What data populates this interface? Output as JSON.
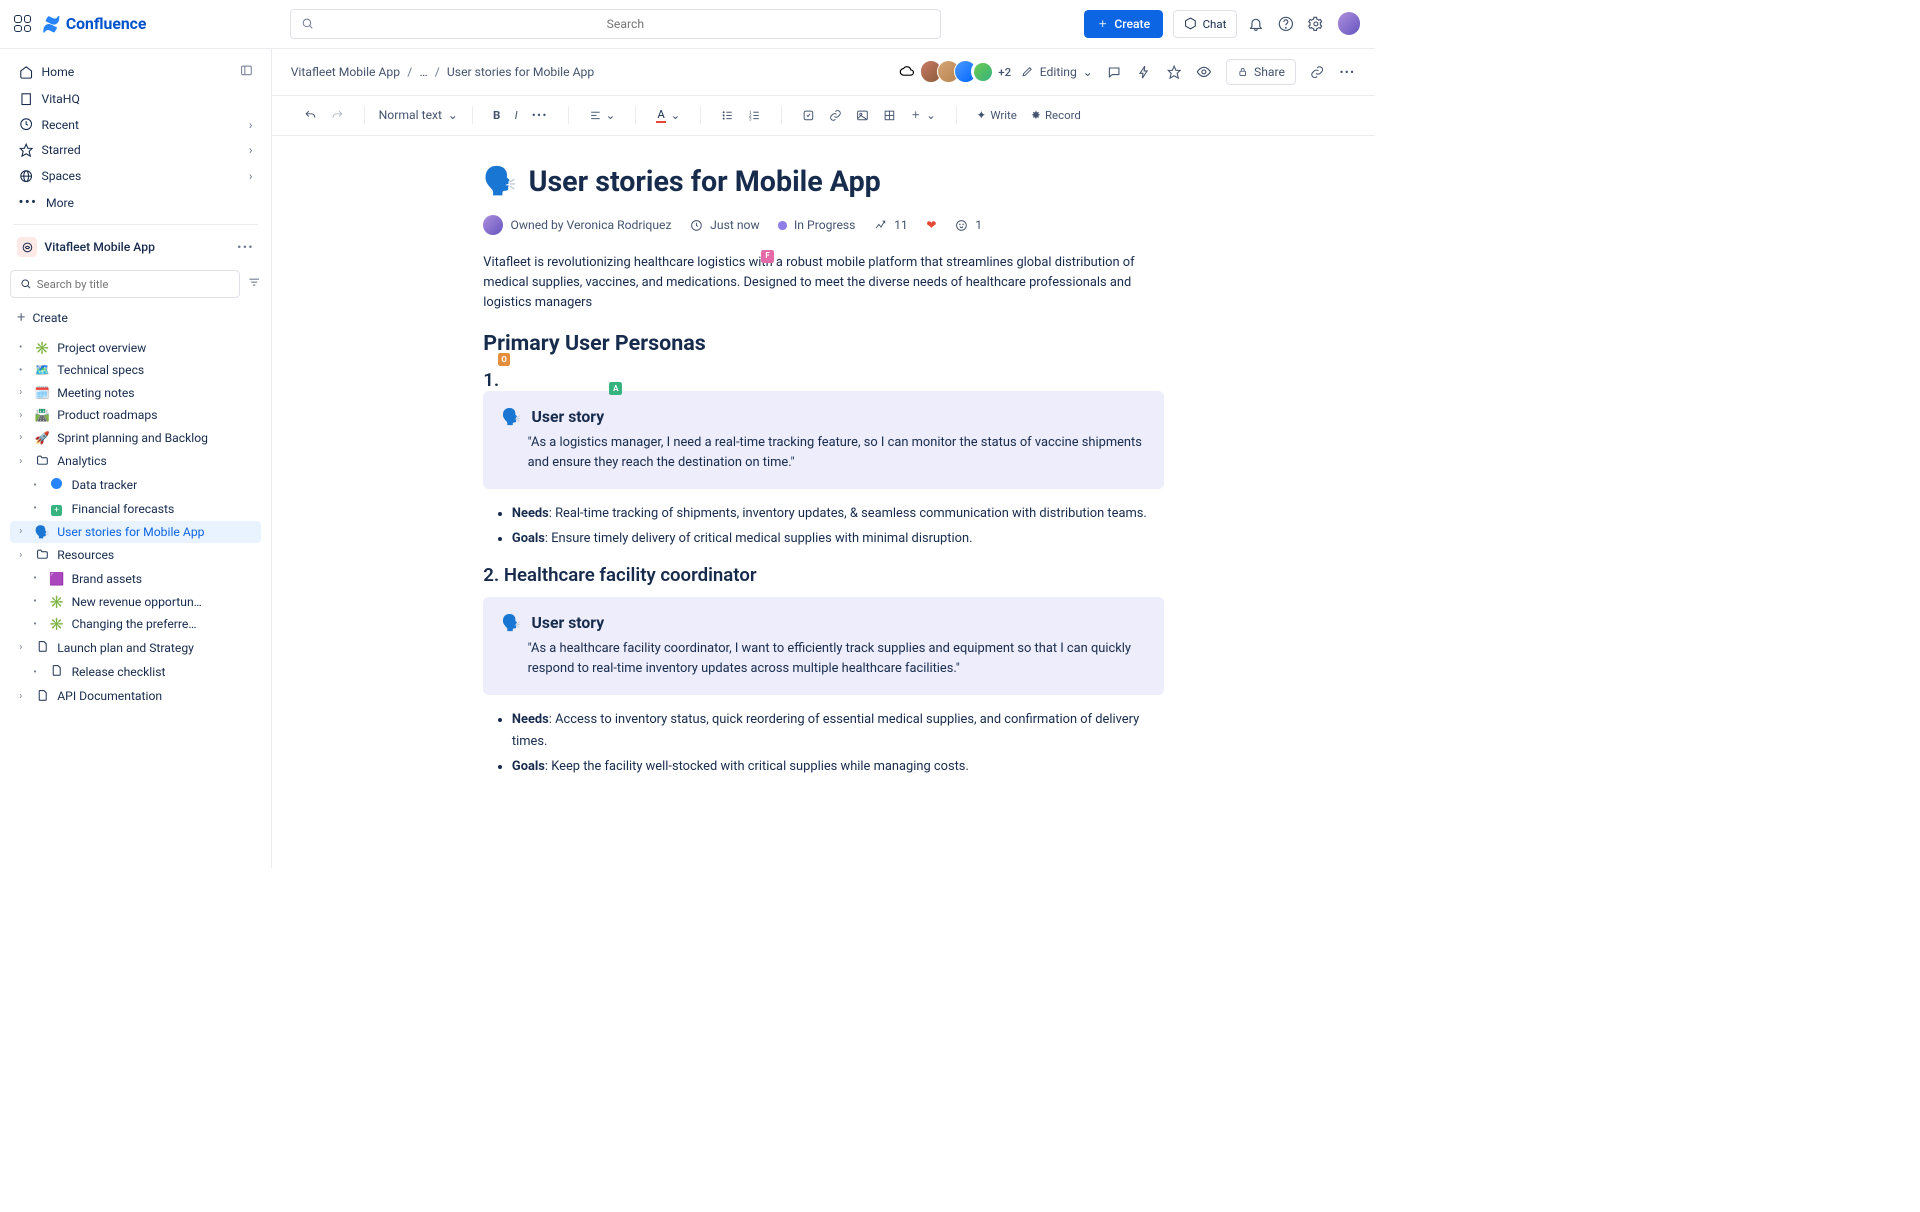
{
  "topbar": {
    "product": "Confluence",
    "search_placeholder": "Search",
    "create": "Create",
    "chat": "Chat"
  },
  "sidebar": {
    "home": "Home",
    "vitahq": "VitaHQ",
    "recent": "Recent",
    "starred": "Starred",
    "spaces": "Spaces",
    "more": "More",
    "space_name": "Vitafleet Mobile App",
    "search_placeholder": "Search by title",
    "create": "Create",
    "tree": [
      {
        "icon": "✳️",
        "label": "Project overview",
        "type": "dot"
      },
      {
        "icon": "🗺️",
        "label": "Technical specs",
        "type": "dot"
      },
      {
        "icon": "🗓️",
        "label": "Meeting notes",
        "type": "chev"
      },
      {
        "icon": "🛣️",
        "label": "Product roadmaps",
        "type": "chev"
      },
      {
        "icon": "🚀",
        "label": "Sprint planning and Backlog",
        "type": "chev"
      },
      {
        "icon": "📁",
        "label": "Analytics",
        "type": "chev",
        "folder": true
      },
      {
        "icon": "🌐",
        "label": "Data tracker",
        "type": "dot",
        "indent": 1,
        "blue": true
      },
      {
        "icon": "➕",
        "label": "Financial forecasts",
        "type": "dot",
        "indent": 1,
        "green": true
      },
      {
        "icon": "🗣️",
        "label": "User stories for Mobile App",
        "type": "chev",
        "active": true
      },
      {
        "icon": "📁",
        "label": "Resources",
        "type": "chev",
        "folder": true
      },
      {
        "icon": "🟪",
        "label": "Brand assets",
        "type": "dot",
        "indent": 1
      },
      {
        "icon": "✳️",
        "label": "New revenue opportun…",
        "type": "dot",
        "indent": 1
      },
      {
        "icon": "✳️",
        "label": "Changing the preferre…",
        "type": "dot",
        "indent": 1
      },
      {
        "icon": "📄",
        "label": "Launch plan and Strategy",
        "type": "chev",
        "page": true
      },
      {
        "icon": "📄",
        "label": "Release checklist",
        "type": "dot",
        "indent": 1,
        "page": true
      },
      {
        "icon": "📄",
        "label": "API Documentation",
        "type": "chev",
        "page": true
      }
    ]
  },
  "header": {
    "breadcrumb": [
      "Vitafleet Mobile App",
      "…",
      "User stories for Mobile App"
    ],
    "plus_count": "+2",
    "editing": "Editing",
    "share": "Share"
  },
  "toolbar": {
    "text_style": "Normal text",
    "write": "Write",
    "record": "Record"
  },
  "doc": {
    "title": "User stories for Mobile App",
    "owner_label": "Owned by Veronica Rodriquez",
    "time": "Just now",
    "status": "In Progress",
    "views": "11",
    "reactions": "1",
    "intro": "Vitafleet is revolutionizing healthcare logistics with a robust mobile platform that streamlines global distribution of medical supplies, vaccines, and medications. Designed to meet the diverse needs of healthcare professionals and logistics managers",
    "h2_personas": "Primary User Personas",
    "num1": "1.",
    "story_label": "User story",
    "story1_body": "\"As a logistics manager, I need a real-time tracking feature, so I can monitor the status of vaccine shipments and ensure they reach the destination on time.\"",
    "needs_label": "Needs",
    "goals_label": "Goals",
    "p1_needs": ": Real-time tracking of shipments, inventory updates, & seamless communication with distribution teams.",
    "p1_goals": ": Ensure timely delivery of critical medical supplies with minimal disruption.",
    "num2": "2.",
    "persona2_title": "Healthcare facility coordinator",
    "story2_body": "\"As a healthcare facility coordinator,  I want to efficiently track supplies and equipment so that I can quickly respond to real-time inventory updates across multiple healthcare facilities.\"",
    "p2_needs": ": Access to inventory status, quick reordering of essential medical supplies, and confirmation of delivery times.",
    "p2_goals": ": Keep the facility well-stocked with critical supplies while managing costs.",
    "flags": {
      "f": "F",
      "o": "O",
      "a": "A"
    }
  }
}
